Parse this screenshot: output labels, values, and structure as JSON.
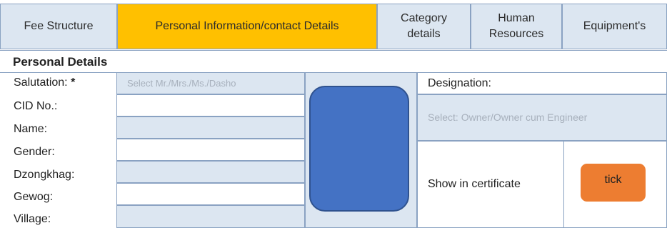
{
  "tabs": [
    {
      "label": "Fee Structure"
    },
    {
      "label": "Personal Information/contact Details",
      "active": true
    },
    {
      "label": "Category details"
    },
    {
      "label": "Human Resources"
    },
    {
      "label": "Equipment's"
    }
  ],
  "section_title": "Personal Details",
  "form": {
    "salutation_label": "Salutation:",
    "required_mark": "*",
    "salutation_placeholder": "Select Mr./Mrs./Ms./Dasho",
    "cid_label": "CID No.:",
    "name_label": "Name:",
    "gender_label": "Gender:",
    "dzongkhag_label": "Dzongkhag:",
    "gewog_label": "Gewog:",
    "village_label": "Village:"
  },
  "designation": {
    "label": "Designation:",
    "placeholder": "Select: Owner/Owner cum Engineer"
  },
  "certificate": {
    "label": "Show in certificate",
    "button_label": "tick"
  },
  "colors": {
    "active_tab": "#ffc000",
    "cell_blue": "#dce6f1",
    "photo_blue": "#4472c4",
    "tick_orange": "#ed7d31"
  }
}
